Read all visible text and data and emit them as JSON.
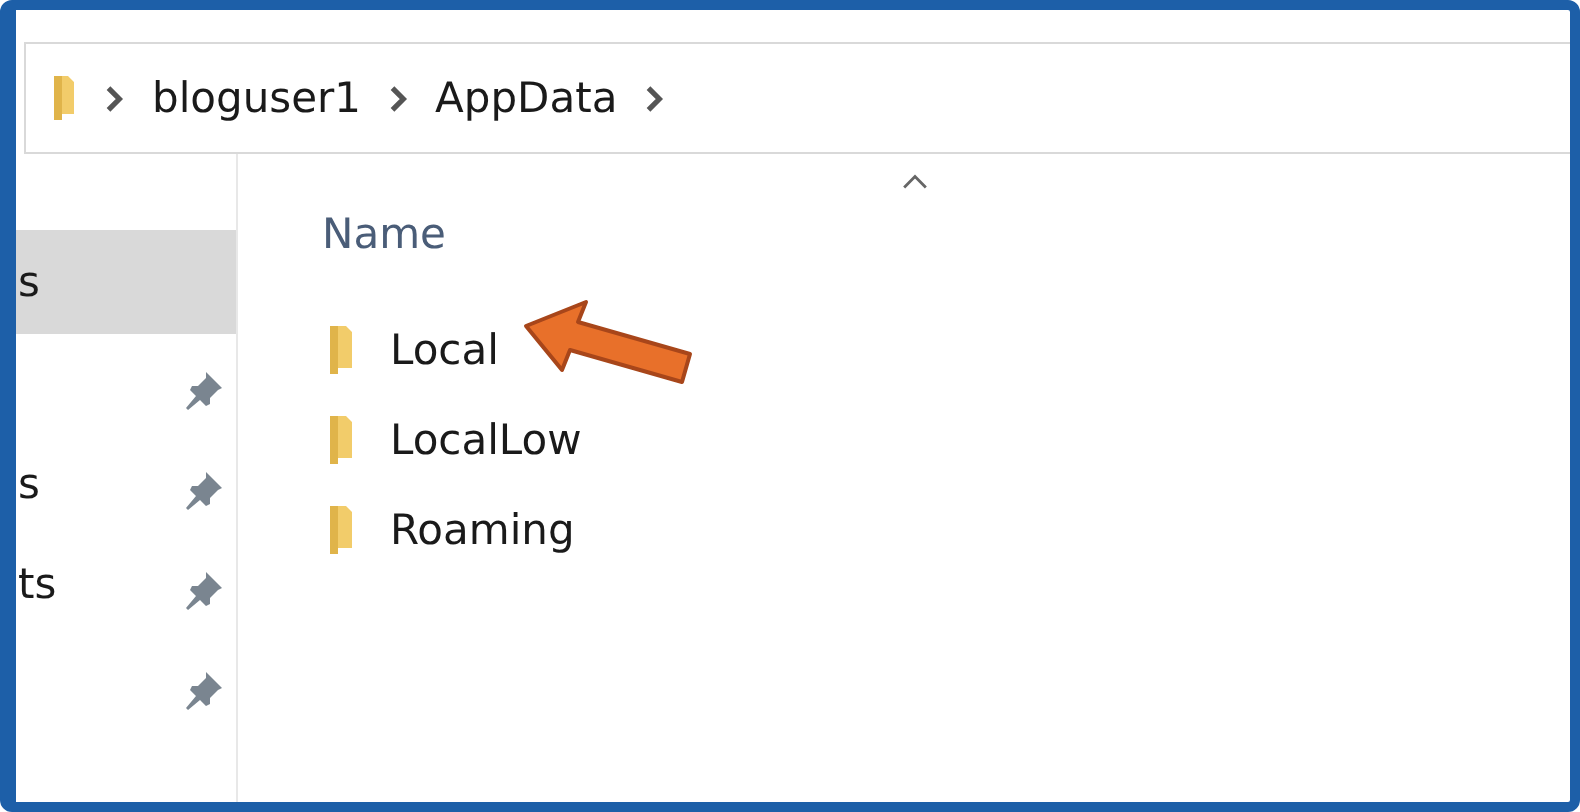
{
  "address_bar": {
    "crumbs": [
      "bloguser1",
      "AppData"
    ]
  },
  "navigation": [
    {
      "text": "s",
      "selected": true,
      "pinned": false
    },
    {
      "selected": false,
      "pinned": true
    },
    {
      "text": "s",
      "selected": false,
      "pinned": true
    },
    {
      "text": "ts",
      "selected": false,
      "pinned": true
    },
    {
      "selected": false,
      "pinned": true
    }
  ],
  "file_list": {
    "columns": [
      "Name"
    ],
    "rows": [
      {
        "name": "Local",
        "selected": false
      },
      {
        "name": "LocalLow",
        "selected": false
      },
      {
        "name": "Roaming",
        "selected": false
      }
    ]
  }
}
